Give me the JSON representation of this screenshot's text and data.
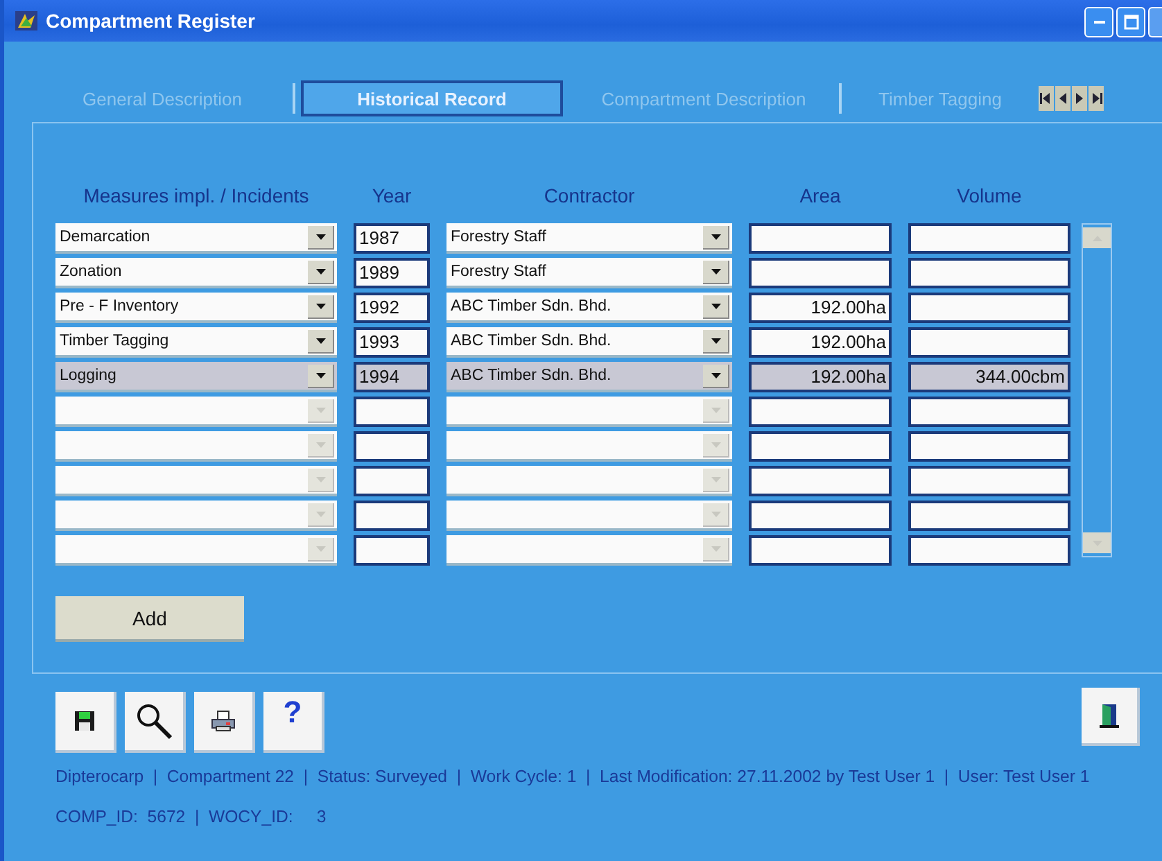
{
  "window": {
    "title": "Compartment Register"
  },
  "tabs": [
    {
      "label": "General Description",
      "selected": false
    },
    {
      "label": "Historical Record",
      "selected": true
    },
    {
      "label": "Compartment Description",
      "selected": false
    },
    {
      "label": "Timber Tagging",
      "selected": false
    }
  ],
  "table": {
    "columns": [
      "Measures impl. / Incidents",
      "Year",
      "Contractor",
      "Area",
      "Volume"
    ],
    "rows": [
      {
        "measure": "Demarcation",
        "year": "1987",
        "contractor": "Forestry Staff",
        "area": "",
        "volume": "",
        "selected": false,
        "disabled": false
      },
      {
        "measure": "Zonation",
        "year": "1989",
        "contractor": "Forestry Staff",
        "area": "",
        "volume": "",
        "selected": false,
        "disabled": false
      },
      {
        "measure": "Pre - F Inventory",
        "year": "1992",
        "contractor": "ABC Timber Sdn. Bhd.",
        "area": "192.00ha",
        "volume": "",
        "selected": false,
        "disabled": false
      },
      {
        "measure": "Timber Tagging",
        "year": "1993",
        "contractor": "ABC Timber Sdn. Bhd.",
        "area": "192.00ha",
        "volume": "",
        "selected": false,
        "disabled": false
      },
      {
        "measure": "Logging",
        "year": "1994",
        "contractor": "ABC Timber Sdn. Bhd.",
        "area": "192.00ha",
        "volume": "344.00cbm",
        "selected": true,
        "disabled": false
      },
      {
        "measure": "",
        "year": "",
        "contractor": "",
        "area": "",
        "volume": "",
        "selected": false,
        "disabled": true
      },
      {
        "measure": "",
        "year": "",
        "contractor": "",
        "area": "",
        "volume": "",
        "selected": false,
        "disabled": true
      },
      {
        "measure": "",
        "year": "",
        "contractor": "",
        "area": "",
        "volume": "",
        "selected": false,
        "disabled": true
      },
      {
        "measure": "",
        "year": "",
        "contractor": "",
        "area": "",
        "volume": "",
        "selected": false,
        "disabled": true
      },
      {
        "measure": "",
        "year": "",
        "contractor": "",
        "area": "",
        "volume": "",
        "selected": false,
        "disabled": true
      }
    ]
  },
  "add_button": "Add",
  "toolbar": [
    {
      "kind": "save"
    },
    {
      "kind": "search"
    },
    {
      "kind": "print"
    },
    {
      "kind": "help",
      "label": "?"
    }
  ],
  "exit_button": {
    "kind": "exit"
  },
  "status_bar": [
    "Dipterocarp  |  Compartment 22  |  Status: Surveyed  |  Work Cycle: 1  |  Last Modification: 27.11.2002 by Test User 1  |  User: Test User 1",
    "COMP_ID:  5672  |  WOCY_ID:     3"
  ]
}
